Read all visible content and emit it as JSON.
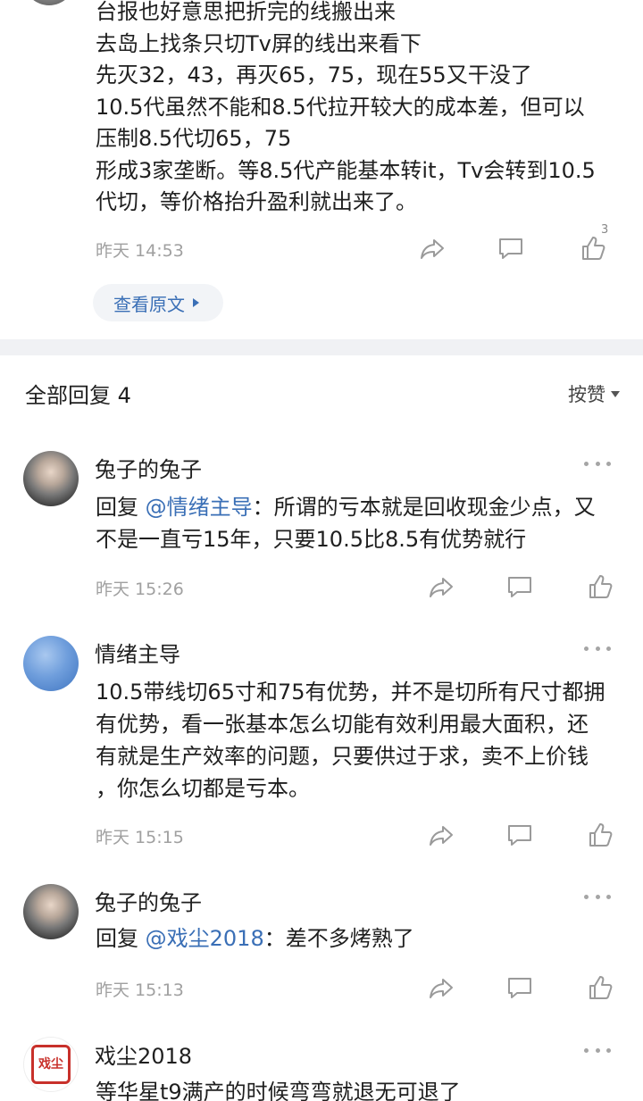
{
  "post": {
    "lines": [
      "台报也好意思把折完的线搬出来",
      "去岛上找条只切Tv屏的线出来看下",
      "先灭32，43，再灭65，75，现在55又干没了",
      "10.5代虽然不能和8.5代拉开较大的成本差，但可以",
      "压制8.5代切65，75",
      "形成3家垄断。等8.5代产能基本转it，Tv会转到10.5",
      "代切，等价格抬升盈利就出来了。"
    ],
    "time": "昨天 14:53",
    "like_count": "3",
    "view_original": "查看原文"
  },
  "replies_header": {
    "title": "全部回复 4",
    "sort_label": "按赞"
  },
  "replies": [
    {
      "user": "兔子的兔子",
      "reply_prefix": "回复 ",
      "mention": "@情绪主导",
      "text_after_mention": "：所谓的亏本就是回收现金少点，又",
      "line2": "不是一直亏15年，只要10.5比8.5有优势就行",
      "time": "昨天 15:26"
    },
    {
      "user": "情绪主导",
      "lines": [
        "10.5带线切65寸和75有优势，并不是切所有尺寸都拥",
        "有优势，看一张基本怎么切能有效利用最大面积，还",
        "有就是生产效率的问题，只要供过于求，卖不上价钱",
        "，你怎么切都是亏本。"
      ],
      "time": "昨天 15:15"
    },
    {
      "user": "兔子的兔子",
      "reply_prefix": "回复 ",
      "mention": "@戏尘2018",
      "text_after_mention": "：差不多烤熟了",
      "time": "昨天 15:13"
    },
    {
      "user": "戏尘2018",
      "text": "等华星t9满产的时候弯弯就退无可退了",
      "avatar_glyph": "戏尘"
    }
  ],
  "icons": {
    "share": "share-icon",
    "comment": "comment-icon",
    "like": "like-icon",
    "more": "more-icon"
  },
  "colors": {
    "link": "#3a6fb6",
    "meta": "#a0a0a0",
    "band": "#f0f1f4"
  }
}
